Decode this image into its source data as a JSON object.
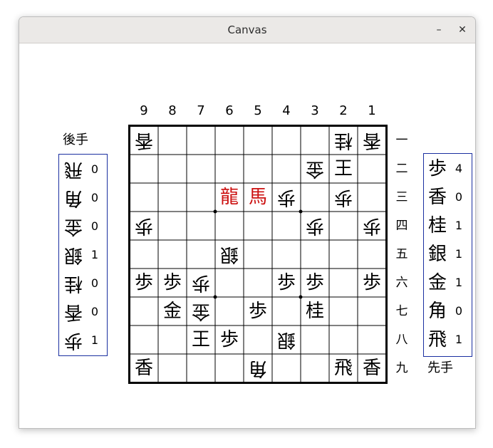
{
  "window": {
    "title": "Canvas",
    "minimize_label": "–",
    "close_label": "✕"
  },
  "files": [
    "9",
    "8",
    "7",
    "6",
    "5",
    "4",
    "3",
    "2",
    "1"
  ],
  "ranks": [
    "一",
    "二",
    "三",
    "四",
    "五",
    "六",
    "七",
    "八",
    "九"
  ],
  "gote_label": "後手",
  "sente_label": "先手",
  "board": [
    [
      {
        "p": "香",
        "side": "gote"
      },
      null,
      null,
      null,
      null,
      null,
      null,
      {
        "p": "桂",
        "side": "gote"
      },
      {
        "p": "香",
        "side": "gote"
      }
    ],
    [
      null,
      null,
      null,
      null,
      null,
      null,
      {
        "p": "金",
        "side": "gote"
      },
      {
        "p": "王",
        "side": "sente"
      },
      null
    ],
    [
      null,
      null,
      null,
      {
        "p": "龍",
        "side": "sente",
        "promoted": true
      },
      {
        "p": "馬",
        "side": "sente",
        "promoted": true
      },
      {
        "p": "歩",
        "side": "gote"
      },
      null,
      {
        "p": "歩",
        "side": "gote"
      },
      null
    ],
    [
      {
        "p": "歩",
        "side": "gote"
      },
      null,
      null,
      null,
      null,
      null,
      {
        "p": "歩",
        "side": "gote"
      },
      null,
      {
        "p": "歩",
        "side": "gote"
      }
    ],
    [
      null,
      null,
      null,
      {
        "p": "銀",
        "side": "gote"
      },
      null,
      null,
      null,
      null,
      null
    ],
    [
      {
        "p": "歩",
        "side": "sente"
      },
      {
        "p": "歩",
        "side": "sente"
      },
      {
        "p": "歩",
        "side": "gote"
      },
      null,
      null,
      {
        "p": "歩",
        "side": "sente"
      },
      {
        "p": "歩",
        "side": "sente"
      },
      null,
      {
        "p": "歩",
        "side": "sente"
      }
    ],
    [
      null,
      {
        "p": "金",
        "side": "sente"
      },
      {
        "p": "金",
        "side": "gote"
      },
      null,
      {
        "p": "歩",
        "side": "sente"
      },
      null,
      {
        "p": "桂",
        "side": "sente"
      },
      null,
      null
    ],
    [
      null,
      null,
      {
        "p": "王",
        "side": "sente"
      },
      {
        "p": "歩",
        "side": "sente"
      },
      null,
      {
        "p": "銀",
        "side": "gote"
      },
      null,
      null,
      null
    ],
    [
      {
        "p": "香",
        "side": "sente"
      },
      null,
      null,
      null,
      {
        "p": "角",
        "side": "gote"
      },
      null,
      null,
      {
        "p": "飛",
        "side": "sente"
      },
      {
        "p": "香",
        "side": "sente"
      }
    ]
  ],
  "gote_hand": [
    {
      "p": "飛",
      "count": "0"
    },
    {
      "p": "角",
      "count": "0"
    },
    {
      "p": "金",
      "count": "0"
    },
    {
      "p": "銀",
      "count": "1"
    },
    {
      "p": "桂",
      "count": "0"
    },
    {
      "p": "香",
      "count": "0"
    },
    {
      "p": "歩",
      "count": "1"
    }
  ],
  "sente_hand": [
    {
      "p": "歩",
      "count": "4"
    },
    {
      "p": "香",
      "count": "0"
    },
    {
      "p": "桂",
      "count": "1"
    },
    {
      "p": "銀",
      "count": "1"
    },
    {
      "p": "金",
      "count": "1"
    },
    {
      "p": "角",
      "count": "0"
    },
    {
      "p": "飛",
      "count": "1"
    }
  ],
  "colors": {
    "promoted": "#cc1111",
    "hand_border": "#1a2fa0",
    "grid": "#000000"
  }
}
